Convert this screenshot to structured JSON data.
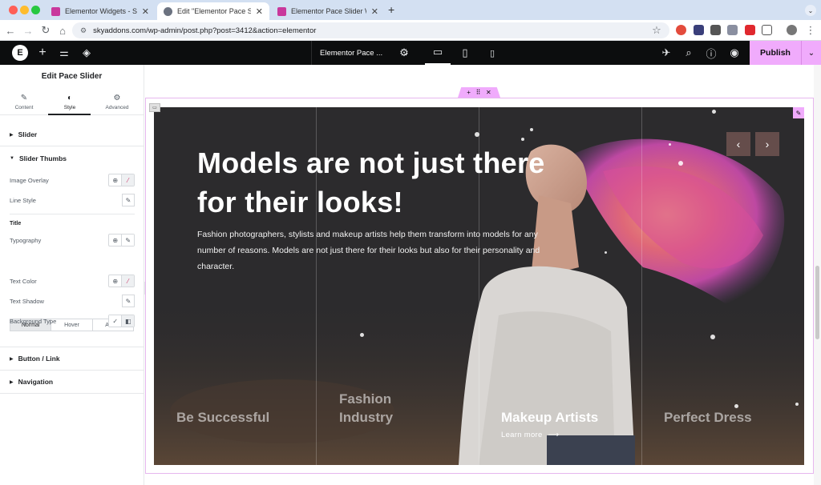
{
  "browser": {
    "tabs": [
      {
        "title": "Elementor Widgets - Sky Add",
        "active": false
      },
      {
        "title": "Edit \"Elementor Pace Slider W",
        "active": true
      },
      {
        "title": "Elementor Pace Slider Widget",
        "active": false
      }
    ],
    "url": "skyaddons.com/wp-admin/post.php?post=3412&action=elementor"
  },
  "topbar": {
    "document_title": "Elementor Pace ...",
    "publish_label": "Publish"
  },
  "panel": {
    "title": "Edit Pace Slider",
    "tabs": [
      {
        "label": "Content",
        "icon": "pencil-icon"
      },
      {
        "label": "Style",
        "icon": "contrast-icon"
      },
      {
        "label": "Advanced",
        "icon": "gear-icon"
      }
    ],
    "sections": {
      "slider": "Slider",
      "slider_thumbs": "Slider Thumbs",
      "button_link": "Button / Link",
      "navigation": "Navigation"
    },
    "controls": {
      "image_overlay": "Image Overlay",
      "line_style": "Line Style",
      "title_heading": "Title",
      "typography": "Typography",
      "text_color": "Text Color",
      "text_shadow": "Text Shadow",
      "background_type": "Background Type"
    },
    "state_tabs": [
      "Normal",
      "Hover",
      "Active"
    ]
  },
  "slider": {
    "headline": "Models are not just there for their looks!",
    "description": "Fashion photographers, stylists and makeup artists help them transform into models for any number of reasons. Models are not just there for their looks but also for their personality and character.",
    "thumbs": [
      {
        "title": "Be Successful",
        "active": false
      },
      {
        "title": "Fashion Industry",
        "active": false
      },
      {
        "title": "Makeup Artists",
        "active": true
      },
      {
        "title": "Perfect Dress",
        "active": false
      }
    ],
    "learn_more": "Learn more",
    "prev_arrow": "‹",
    "next_arrow": "›"
  },
  "colors": {
    "accent": "#f0abfc",
    "topbar": "#0c0d0e"
  }
}
